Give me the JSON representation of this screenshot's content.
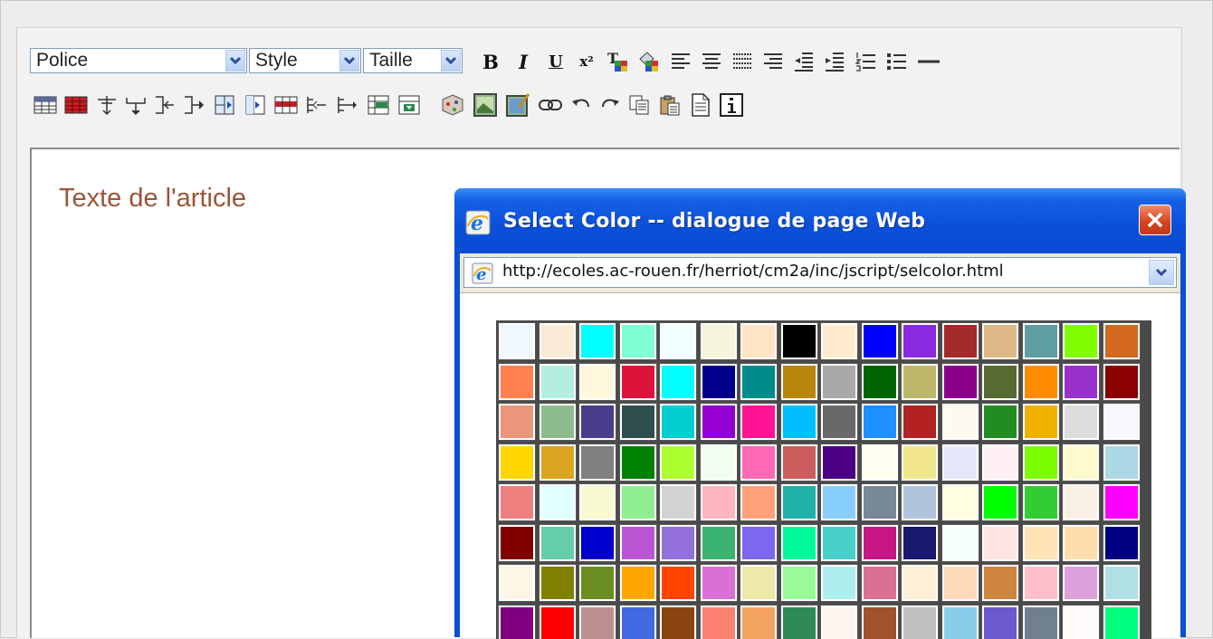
{
  "toolbar": {
    "font_combo": {
      "label": "Police"
    },
    "style_combo": {
      "label": "Style"
    },
    "size_combo": {
      "label": "Taille"
    },
    "bold_label": "B",
    "italic_label": "I",
    "underline_label": "U",
    "superscript_label": "x²",
    "row1_icons": [
      "bold-icon",
      "italic-icon",
      "underline-icon",
      "superscript-icon",
      "text-color-icon",
      "background-color-icon",
      "align-left-icon",
      "align-center-icon",
      "justify-icon",
      "align-right-icon",
      "outdent-icon",
      "indent-icon",
      "numbered-list-icon",
      "bullet-list-icon",
      "horizontal-rule-icon"
    ],
    "row2_icons": [
      "insert-table-icon",
      "table-properties-icon",
      "insert-row-above-icon",
      "insert-row-below-icon",
      "delete-row-icon",
      "insert-column-icon",
      "split-cell-icon",
      "merge-cell-icon",
      "cell-properties-icon",
      "insert-column-left-icon",
      "insert-column-right-icon",
      "delete-column-icon",
      "table-cell-icon",
      "insert-object-icon",
      "insert-image-icon",
      "edit-image-icon",
      "link-icon",
      "undo-icon",
      "redo-icon",
      "copy-icon",
      "paste-icon",
      "document-icon",
      "info-icon"
    ]
  },
  "editor": {
    "article_title": "Texte de l'article"
  },
  "dialog": {
    "title": "Select Color -- dialogue de page Web",
    "address": "http://ecoles.ac-rouen.fr/herriot/cm2a/inc/jscript/selcolor.html",
    "palette": [
      [
        "#F0F8FF",
        "#FAEBD7",
        "#00FFFF",
        "#7FFFD4",
        "#F0FFFF",
        "#F5F5DC",
        "#FFE4C4",
        "#000000",
        "#FFEBCD",
        "#0000FF",
        "#8A2BE2",
        "#A52A2A",
        "#DEB887",
        "#5F9EA0",
        "#7FFF00",
        "#D2691E"
      ],
      [
        "#FF7F50",
        "#B4EEDF",
        "#FFF8DC",
        "#DC143C",
        "#00FFFF",
        "#00008B",
        "#008B8B",
        "#B8860B",
        "#A9A9A9",
        "#006400",
        "#BDB76B",
        "#8B008B",
        "#556B2F",
        "#FF8C00",
        "#9932CC",
        "#8B0000"
      ],
      [
        "#E9967A",
        "#8FBC8F",
        "#483D8B",
        "#2F4F4F",
        "#00CED1",
        "#9400D3",
        "#FF1493",
        "#00BFFF",
        "#696969",
        "#1E90FF",
        "#B22222",
        "#FFFAF0",
        "#228B22",
        "#F0B000",
        "#DCDCDC",
        "#F8F8FF"
      ],
      [
        "#FFD700",
        "#DAA520",
        "#808080",
        "#008000",
        "#ADFF2F",
        "#F0FFF0",
        "#FF69B4",
        "#CD5C5C",
        "#4B0082",
        "#FFFFF0",
        "#F0E68C",
        "#E6E6FA",
        "#FFF0F5",
        "#7CFC00",
        "#FFFACD",
        "#ADD8E6"
      ],
      [
        "#F08080",
        "#E0FFFF",
        "#FAFAD2",
        "#90EE90",
        "#D3D3D3",
        "#FFB6C1",
        "#FFA07A",
        "#20B2AA",
        "#87CEFA",
        "#778899",
        "#B0C4DE",
        "#FFFFE0",
        "#00FF00",
        "#32CD32",
        "#FAF0E6",
        "#FF00FF"
      ],
      [
        "#800000",
        "#66CDAA",
        "#0000CD",
        "#BA55D3",
        "#9370DB",
        "#3CB371",
        "#7B68EE",
        "#00FA9A",
        "#48D1CC",
        "#C71585",
        "#191970",
        "#F5FFFA",
        "#FFE4E1",
        "#FFE4B5",
        "#FFDEAD",
        "#000080"
      ],
      [
        "#FDF5E6",
        "#808000",
        "#6B8E23",
        "#FFA500",
        "#FF4500",
        "#DA70D6",
        "#EEE8AA",
        "#98FB98",
        "#AFEEEE",
        "#DB7093",
        "#FFEFD5",
        "#FFDAB9",
        "#CD853F",
        "#FFC0CB",
        "#DDA0DD",
        "#B0E0E6"
      ],
      [
        "#800080",
        "#FF0000",
        "#BC8F8F",
        "#4169E1",
        "#8B4513",
        "#FA8072",
        "#F4A460",
        "#2E8B57",
        "#FFF5EE",
        "#A0522D",
        "#C0C0C0",
        "#87CEEB",
        "#6A5ACD",
        "#708090",
        "#FFFAFA",
        "#00FF7F"
      ]
    ]
  }
}
